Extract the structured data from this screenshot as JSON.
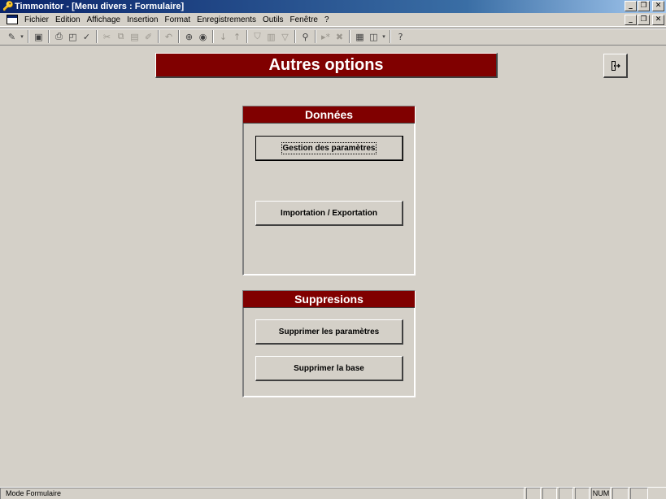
{
  "window": {
    "title": "Timmonitor - [Menu divers : Formulaire]"
  },
  "menu": {
    "items": [
      "Fichier",
      "Edition",
      "Affichage",
      "Insertion",
      "Format",
      "Enregistrements",
      "Outils",
      "Fenêtre",
      "?"
    ]
  },
  "form": {
    "header": "Autres options",
    "groups": [
      {
        "title": "Données",
        "buttons": [
          "Gestion des paramètres",
          "Importation / Exportation"
        ]
      },
      {
        "title": "Suppresions",
        "buttons": [
          "Supprimer les paramètres",
          "Supprimer la base"
        ]
      }
    ]
  },
  "status": {
    "mode": "Mode Formulaire",
    "num": "NUM"
  },
  "colors": {
    "header_bg": "#800000",
    "window_bg": "#d4d0c8",
    "titlebar": "#0a246a"
  },
  "icons": [
    "app-key-icon",
    "form-view-icon",
    "save-icon",
    "print-icon",
    "print-preview-icon",
    "spellcheck-icon",
    "cut-icon",
    "copy-icon",
    "paste-icon",
    "format-painter-icon",
    "undo-icon",
    "hyperlink-icon",
    "web-icon",
    "sort-ascending-icon",
    "sort-descending-icon",
    "filter-by-selection-icon",
    "filter-by-form-icon",
    "apply-filter-icon",
    "find-icon",
    "new-record-icon",
    "delete-record-icon",
    "database-window-icon",
    "new-object-icon",
    "help-icon",
    "exit-door-icon"
  ]
}
